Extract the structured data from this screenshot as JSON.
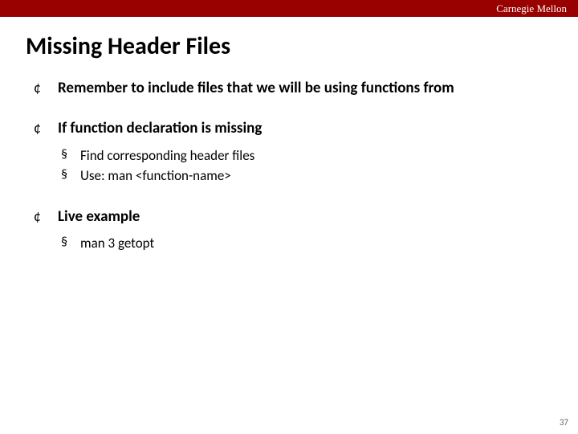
{
  "header": {
    "brand": "Carnegie Mellon"
  },
  "title": "Missing Header Files",
  "bullets": [
    {
      "text": "Remember to include files that we will be using functions from",
      "sub": []
    },
    {
      "text": "If function declaration is missing",
      "sub": [
        "Find corresponding header files",
        "Use: man <function-name>"
      ]
    },
    {
      "text": "Live example",
      "sub": [
        "man 3 getopt"
      ]
    }
  ],
  "page_number": "37"
}
